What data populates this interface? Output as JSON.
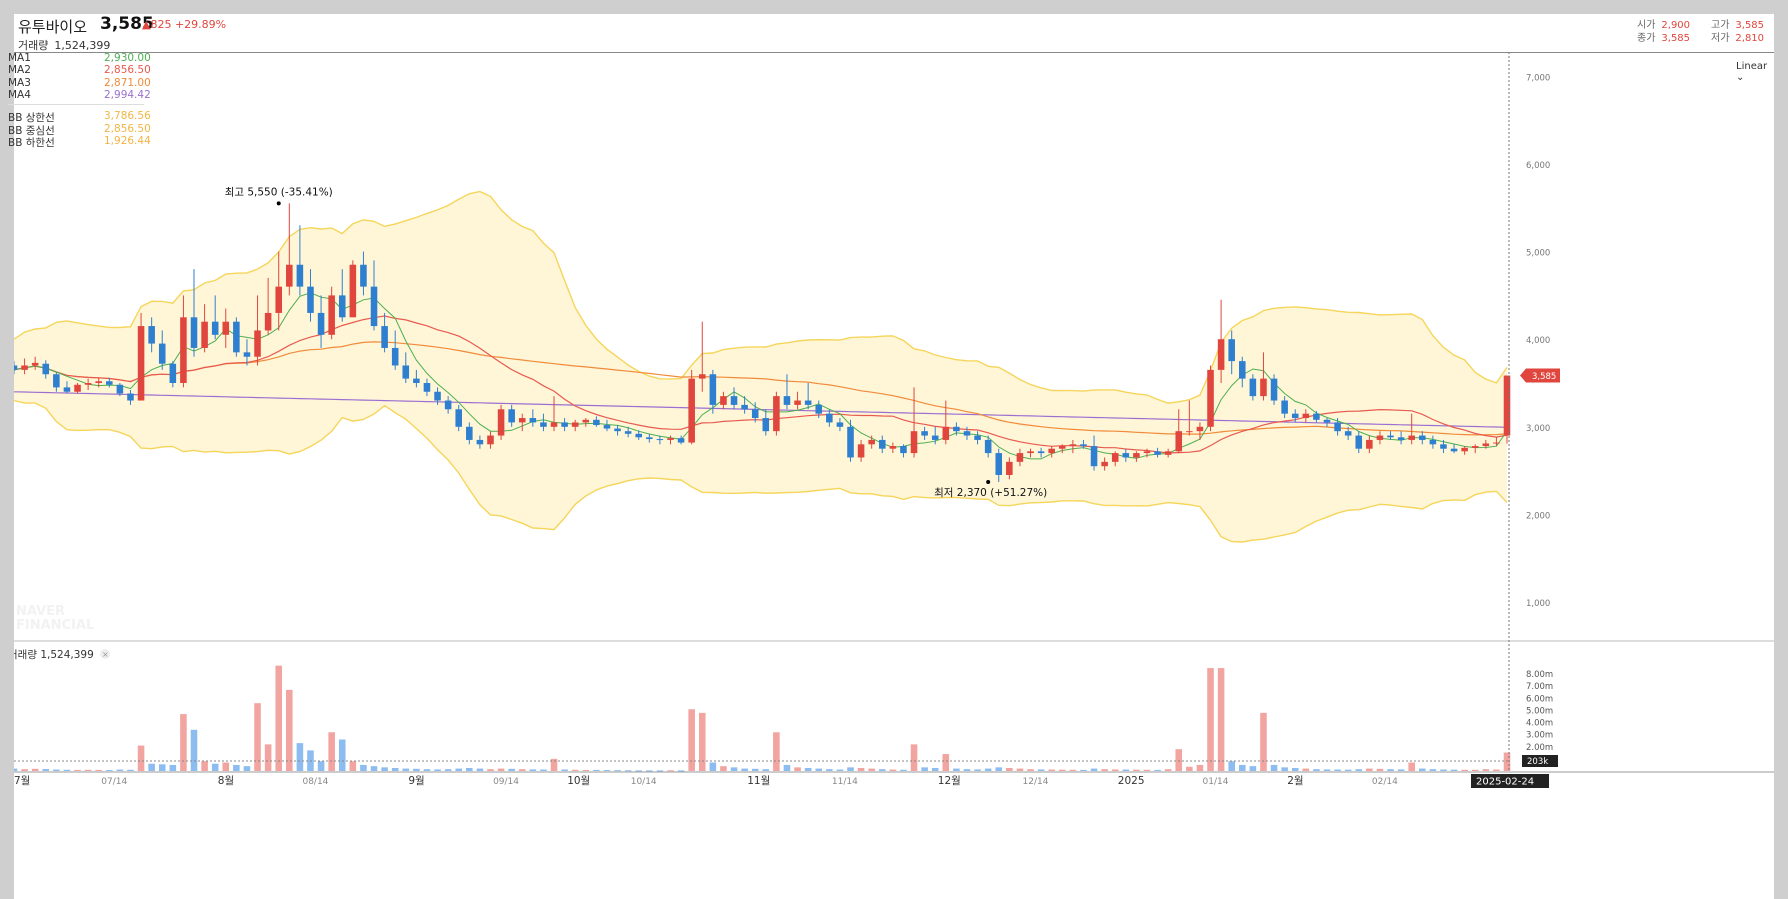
{
  "header": {
    "name": "유투바이오",
    "price": "3,585",
    "change": "▲825",
    "change_pct": "+29.89%",
    "volume_label": "거래량",
    "volume": "1,524,399",
    "open_label": "시가",
    "open": "2,900",
    "high_label": "고가",
    "high": "3,585",
    "close_label": "종가",
    "close": "3,585",
    "low_label": "저가",
    "low": "2,810"
  },
  "legend": {
    "ma": [
      {
        "label": "MA1",
        "value": "2,930.00",
        "color": "#4caf50"
      },
      {
        "label": "MA2",
        "value": "2,856.50",
        "color": "#e85a4f"
      },
      {
        "label": "MA3",
        "value": "2,871.00",
        "color": "#f08b3a"
      },
      {
        "label": "MA4",
        "value": "2,994.42",
        "color": "#9b6fd1"
      }
    ],
    "bb": [
      {
        "label": "BB 상한선",
        "value": "3,786.56",
        "color": "#f2b544"
      },
      {
        "label": "BB 중심선",
        "value": "2,856.50",
        "color": "#f2b544"
      },
      {
        "label": "BB 하한선",
        "value": "1,926.44",
        "color": "#f2b544"
      }
    ]
  },
  "controls": {
    "scale_mode": "Linear",
    "scale_chevron_icon": "chevron-down-icon"
  },
  "volume_panel": {
    "label": "거래량",
    "value": "1,524,399",
    "close_icon": "close-icon"
  },
  "watermark": [
    "NAVER",
    "FINANCIAL"
  ],
  "chart_data": {
    "type": "candlestick",
    "colors": {
      "up": "#e0463d",
      "down": "#2f7fd1",
      "band_fill": "#fff6d8",
      "band_line": "#f5d55a"
    },
    "ylim": [
      1000,
      7000
    ],
    "yticks": [
      1000,
      2000,
      3000,
      4000,
      5000,
      6000,
      7000
    ],
    "ytick_labels": [
      "1,000",
      "2,000",
      "3,000",
      "4,000",
      "5,000",
      "6,000",
      "7,000"
    ],
    "volume_ylim": [
      0,
      9000000
    ],
    "volume_ticks": [
      "8.00m",
      "7.00m",
      "6.00m",
      "5.00m",
      "4.00m",
      "3.00m",
      "2.00m",
      "1.00m"
    ],
    "volume_ticks_values": [
      8000000,
      7000000,
      6000000,
      5000000,
      4000000,
      3000000,
      2000000,
      1000000
    ],
    "volume_current_tag": "203k",
    "price_tag": "3,585",
    "x_labels": [
      {
        "i": 0,
        "label": "7월"
      },
      {
        "i": 9,
        "label": "07/14"
      },
      {
        "i": 20,
        "label": "8월"
      },
      {
        "i": 28,
        "label": "08/14"
      },
      {
        "i": 38,
        "label": "9월"
      },
      {
        "i": 46,
        "label": "09/14"
      },
      {
        "i": 53,
        "label": "10월"
      },
      {
        "i": 59,
        "label": "10/14"
      },
      {
        "i": 70,
        "label": "11월"
      },
      {
        "i": 78,
        "label": "11/14"
      },
      {
        "i": 88,
        "label": "12월"
      },
      {
        "i": 96,
        "label": "12/14"
      },
      {
        "i": 105,
        "label": "2025"
      },
      {
        "i": 113,
        "label": "01/14"
      },
      {
        "i": 121,
        "label": "2월"
      },
      {
        "i": 129,
        "label": "02/14"
      }
    ],
    "current_date": "2025-02-24",
    "annotations": [
      {
        "i": 25,
        "value": 5550,
        "text": "최고 5,550 (-35.41%)"
      },
      {
        "i": 92,
        "value": 2370,
        "text": "최저 2,370 (+51.27%)"
      }
    ],
    "candles": [
      [
        3700,
        3750,
        3600,
        3650,
        200000
      ],
      [
        3650,
        3780,
        3600,
        3700,
        150000
      ],
      [
        3700,
        3800,
        3650,
        3730,
        180000
      ],
      [
        3720,
        3760,
        3550,
        3600,
        160000
      ],
      [
        3600,
        3620,
        3400,
        3450,
        120000
      ],
      [
        3450,
        3520,
        3380,
        3400,
        100000
      ],
      [
        3400,
        3500,
        3380,
        3480,
        90000
      ],
      [
        3480,
        3550,
        3420,
        3500,
        100000
      ],
      [
        3500,
        3560,
        3450,
        3520,
        90000
      ],
      [
        3520,
        3560,
        3450,
        3480,
        80000
      ],
      [
        3480,
        3500,
        3350,
        3380,
        120000
      ],
      [
        3380,
        3420,
        3250,
        3300,
        100000
      ],
      [
        3300,
        4300,
        3300,
        4150,
        2100000
      ],
      [
        4150,
        4250,
        3850,
        3950,
        600000
      ],
      [
        3950,
        4100,
        3650,
        3720,
        550000
      ],
      [
        3720,
        3750,
        3450,
        3500,
        500000
      ],
      [
        3500,
        4500,
        3450,
        4250,
        4700000
      ],
      [
        4250,
        4800,
        3800,
        3900,
        3400000
      ],
      [
        3900,
        4400,
        3850,
        4200,
        800000
      ],
      [
        4200,
        4500,
        4000,
        4050,
        600000
      ],
      [
        4050,
        4350,
        3900,
        4200,
        700000
      ],
      [
        4200,
        4250,
        3800,
        3850,
        500000
      ],
      [
        3850,
        4000,
        3700,
        3800,
        400000
      ],
      [
        3800,
        4500,
        3700,
        4100,
        5600000
      ],
      [
        4100,
        4700,
        4050,
        4300,
        2200000
      ],
      [
        4300,
        5000,
        4100,
        4600,
        8700000
      ],
      [
        4600,
        5550,
        4500,
        4850,
        6700000
      ],
      [
        4850,
        5300,
        4500,
        4600,
        2300000
      ],
      [
        4600,
        4800,
        4200,
        4300,
        1700000
      ],
      [
        4300,
        4500,
        3900,
        4050,
        800000
      ],
      [
        4050,
        4600,
        4000,
        4500,
        3200000
      ],
      [
        4500,
        4800,
        4200,
        4250,
        2600000
      ],
      [
        4250,
        4900,
        4250,
        4850,
        800000
      ],
      [
        4850,
        5000,
        4500,
        4600,
        500000
      ],
      [
        4600,
        4900,
        4100,
        4150,
        400000
      ],
      [
        4150,
        4300,
        3850,
        3900,
        300000
      ],
      [
        3900,
        4100,
        3650,
        3700,
        250000
      ],
      [
        3700,
        3850,
        3500,
        3550,
        200000
      ],
      [
        3550,
        3650,
        3450,
        3500,
        180000
      ],
      [
        3500,
        3550,
        3350,
        3400,
        150000
      ],
      [
        3400,
        3450,
        3250,
        3300,
        130000
      ],
      [
        3300,
        3350,
        3150,
        3200,
        150000
      ],
      [
        3200,
        3250,
        2950,
        3000,
        200000
      ],
      [
        3000,
        3050,
        2800,
        2850,
        250000
      ],
      [
        2850,
        2900,
        2750,
        2800,
        200000
      ],
      [
        2800,
        2950,
        2750,
        2900,
        150000
      ],
      [
        2900,
        3250,
        2850,
        3200,
        200000
      ],
      [
        3200,
        3250,
        3000,
        3050,
        180000
      ],
      [
        3050,
        3150,
        2950,
        3100,
        150000
      ],
      [
        3100,
        3200,
        3000,
        3050,
        130000
      ],
      [
        3050,
        3150,
        2950,
        3000,
        120000
      ],
      [
        3000,
        3350,
        2950,
        3050,
        1000000
      ],
      [
        3050,
        3100,
        2950,
        3000,
        120000
      ],
      [
        3000,
        3080,
        2950,
        3050,
        100000
      ],
      [
        3050,
        3100,
        3000,
        3080,
        80000
      ],
      [
        3080,
        3120,
        3000,
        3020,
        90000
      ],
      [
        3020,
        3080,
        2950,
        2980,
        80000
      ],
      [
        2980,
        3020,
        2900,
        2950,
        70000
      ],
      [
        2950,
        3000,
        2880,
        2920,
        60000
      ],
      [
        2920,
        2960,
        2850,
        2880,
        50000
      ],
      [
        2880,
        2920,
        2820,
        2860,
        50000
      ],
      [
        2860,
        2900,
        2800,
        2850,
        50000
      ],
      [
        2850,
        2900,
        2800,
        2870,
        60000
      ],
      [
        2870,
        2900,
        2800,
        2820,
        50000
      ],
      [
        2820,
        3650,
        2800,
        3550,
        5100000
      ],
      [
        3550,
        4200,
        3400,
        3600,
        4800000
      ],
      [
        3600,
        3650,
        3150,
        3250,
        700000
      ],
      [
        3250,
        3400,
        3200,
        3350,
        400000
      ],
      [
        3350,
        3450,
        3200,
        3250,
        300000
      ],
      [
        3250,
        3350,
        3150,
        3200,
        200000
      ],
      [
        3200,
        3280,
        3050,
        3100,
        180000
      ],
      [
        3100,
        3200,
        2900,
        2950,
        150000
      ],
      [
        2950,
        3400,
        2900,
        3350,
        3200000
      ],
      [
        3350,
        3600,
        3200,
        3250,
        500000
      ],
      [
        3250,
        3400,
        3200,
        3300,
        300000
      ],
      [
        3300,
        3500,
        3200,
        3250,
        250000
      ],
      [
        3250,
        3300,
        3100,
        3150,
        200000
      ],
      [
        3150,
        3200,
        3000,
        3050,
        150000
      ],
      [
        3050,
        3100,
        2950,
        3000,
        120000
      ],
      [
        3000,
        3080,
        2600,
        2650,
        300000
      ],
      [
        2650,
        2850,
        2600,
        2800,
        250000
      ],
      [
        2800,
        2900,
        2750,
        2850,
        200000
      ],
      [
        2850,
        2900,
        2700,
        2750,
        150000
      ],
      [
        2750,
        2820,
        2700,
        2780,
        120000
      ],
      [
        2780,
        2800,
        2650,
        2700,
        100000
      ],
      [
        2700,
        3450,
        2650,
        2950,
        2200000
      ],
      [
        2950,
        3000,
        2850,
        2900,
        300000
      ],
      [
        2900,
        3000,
        2800,
        2850,
        250000
      ],
      [
        2850,
        3300,
        2800,
        3000,
        1400000
      ],
      [
        3000,
        3050,
        2900,
        2950,
        200000
      ],
      [
        2950,
        3000,
        2850,
        2900,
        150000
      ],
      [
        2900,
        2950,
        2800,
        2850,
        130000
      ],
      [
        2850,
        2900,
        2650,
        2700,
        200000
      ],
      [
        2700,
        2750,
        2370,
        2450,
        300000
      ],
      [
        2450,
        2650,
        2400,
        2600,
        250000
      ],
      [
        2600,
        2750,
        2550,
        2700,
        200000
      ],
      [
        2700,
        2750,
        2650,
        2720,
        150000
      ],
      [
        2720,
        2760,
        2650,
        2700,
        130000
      ],
      [
        2700,
        2780,
        2650,
        2750,
        120000
      ],
      [
        2750,
        2800,
        2700,
        2780,
        110000
      ],
      [
        2780,
        2850,
        2700,
        2800,
        100000
      ],
      [
        2800,
        2850,
        2750,
        2780,
        90000
      ],
      [
        2780,
        2900,
        2500,
        2550,
        200000
      ],
      [
        2550,
        2650,
        2500,
        2600,
        150000
      ],
      [
        2600,
        2720,
        2550,
        2700,
        130000
      ],
      [
        2700,
        2750,
        2600,
        2650,
        120000
      ],
      [
        2650,
        2720,
        2600,
        2700,
        110000
      ],
      [
        2700,
        2750,
        2650,
        2720,
        100000
      ],
      [
        2720,
        2760,
        2650,
        2680,
        90000
      ],
      [
        2680,
        2750,
        2650,
        2720,
        150000
      ],
      [
        2720,
        3200,
        2700,
        2950,
        1800000
      ],
      [
        2950,
        3300,
        2900,
        2950,
        350000
      ],
      [
        2950,
        3050,
        2850,
        3000,
        500000
      ],
      [
        3000,
        3700,
        2950,
        3650,
        8500000
      ],
      [
        3650,
        4450,
        3500,
        4000,
        8500000
      ],
      [
        4000,
        4100,
        3600,
        3750,
        800000
      ],
      [
        3750,
        3800,
        3450,
        3550,
        500000
      ],
      [
        3550,
        3600,
        3300,
        3350,
        400000
      ],
      [
        3350,
        3850,
        3300,
        3550,
        4800000
      ],
      [
        3550,
        3600,
        3250,
        3300,
        500000
      ],
      [
        3300,
        3350,
        3100,
        3150,
        300000
      ],
      [
        3150,
        3200,
        3050,
        3100,
        250000
      ],
      [
        3100,
        3200,
        3050,
        3150,
        200000
      ],
      [
        3150,
        3180,
        3050,
        3080,
        150000
      ],
      [
        3080,
        3100,
        3000,
        3050,
        130000
      ],
      [
        3050,
        3100,
        2900,
        2950,
        120000
      ],
      [
        2950,
        3000,
        2850,
        2900,
        110000
      ],
      [
        2900,
        2950,
        2700,
        2750,
        150000
      ],
      [
        2750,
        2900,
        2700,
        2850,
        200000
      ],
      [
        2850,
        2950,
        2800,
        2900,
        180000
      ],
      [
        2900,
        2950,
        2850,
        2880,
        150000
      ],
      [
        2880,
        2950,
        2800,
        2850,
        130000
      ],
      [
        2850,
        3150,
        2800,
        2900,
        700000
      ],
      [
        2900,
        2950,
        2800,
        2850,
        200000
      ],
      [
        2850,
        2900,
        2750,
        2800,
        150000
      ],
      [
        2800,
        2850,
        2700,
        2750,
        120000
      ],
      [
        2750,
        2800,
        2700,
        2720,
        110000
      ],
      [
        2720,
        2780,
        2680,
        2760,
        100000
      ],
      [
        2760,
        2800,
        2700,
        2780,
        100000
      ],
      [
        2780,
        2850,
        2750,
        2810,
        150000
      ],
      [
        2810,
        2880,
        2780,
        2820,
        120000
      ],
      [
        2900,
        3585,
        2810,
        3585,
        1524399
      ]
    ],
    "series_lines": {
      "ma4_start": 3400,
      "ma4_end": 2994.42
    }
  }
}
